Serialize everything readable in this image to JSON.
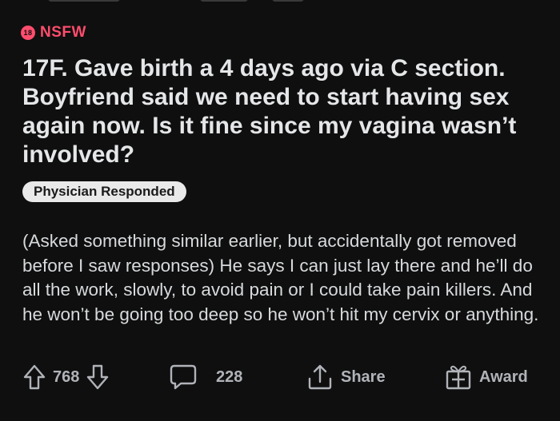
{
  "post": {
    "nsfw_badge": "18",
    "nsfw_label": "NSFW",
    "title": "17F. Gave birth a 4 days ago via C section. Boyfriend said we need to start having sex again now. Is it fine since my vagina wasn’t involved?",
    "flair": "Physician Responded",
    "body": "(Asked something similar earlier, but accidentally got removed before I saw responses) He says I can just lay there and he’ll do all the work, slowly, to avoid pain or I could take pain killers. And he won’t be going too deep so he won’t hit my cervix or anything."
  },
  "actions": {
    "vote_count": "768",
    "comment_count": "228",
    "share_label": "Share",
    "award_label": "Award"
  },
  "icons": {
    "nsfw": "nsfw-18-icon",
    "upvote": "upvote-arrow-icon",
    "downvote": "downvote-arrow-icon",
    "comment": "comment-bubble-icon",
    "share": "share-icon",
    "award": "award-gift-icon"
  },
  "colors": {
    "background": "#0f0f0f",
    "nsfw": "#ff4d6d",
    "title": "#e4e6e8",
    "flair_bg": "#e9e9ea",
    "action": "#b0b3b8"
  }
}
